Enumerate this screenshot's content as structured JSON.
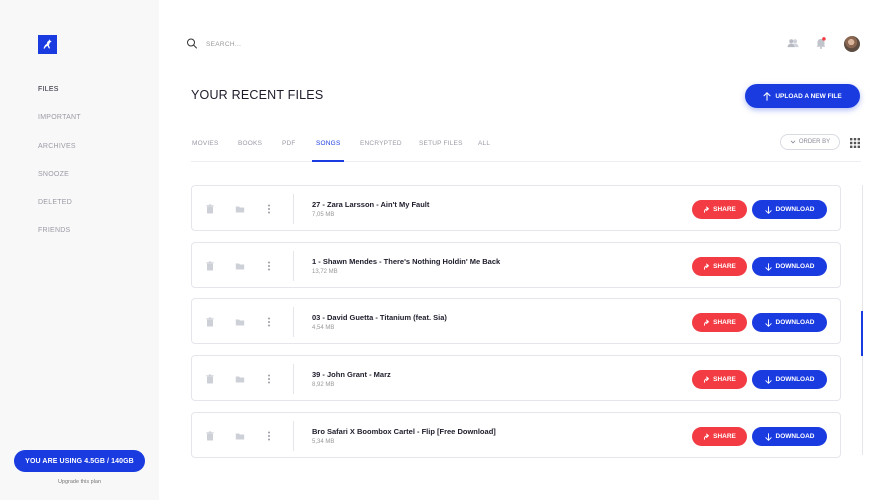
{
  "colors": {
    "brand": "#1a3be0",
    "share": "#f23b43",
    "notification": "#f23b43"
  },
  "sidebar": {
    "logo_icon": "kangaroo-logo-icon",
    "items": [
      {
        "label": "FILES",
        "active": true
      },
      {
        "label": "IMPORTANT",
        "active": false
      },
      {
        "label": "ARCHIVES",
        "active": false
      },
      {
        "label": "SNOOZE",
        "active": false
      },
      {
        "label": "DELETED",
        "active": false
      },
      {
        "label": "FRIENDS",
        "active": false
      }
    ],
    "usage_label": "YOU ARE USING 4.5GB / 140GB",
    "upgrade_label": "Upgrade this plan"
  },
  "header": {
    "search_placeholder": "SEARCH...",
    "icons": [
      "search-icon",
      "users-icon",
      "bell-icon",
      "avatar"
    ]
  },
  "main": {
    "title": "YOUR RECENT FILES",
    "upload_label": "UPLOAD A NEW FILE",
    "tabs": [
      {
        "label": "MOVIES",
        "active": false
      },
      {
        "label": "BOOKS",
        "active": false
      },
      {
        "label": "PDF",
        "active": false
      },
      {
        "label": "SONGS",
        "active": true
      },
      {
        "label": "ENCRYPTED",
        "active": false
      },
      {
        "label": "SETUP FILES",
        "active": false
      },
      {
        "label": "ALL",
        "active": false
      }
    ],
    "order_label": "ORDER BY",
    "files": [
      {
        "name": "27 - Zara Larsson - Ain't My Fault",
        "size": "7,05 MB"
      },
      {
        "name": "1 - Shawn Mendes - There's Nothing Holdin' Me Back",
        "size": "13,72 MB"
      },
      {
        "name": "03 - David Guetta - Titanium (feat. Sia)",
        "size": "4,54 MB"
      },
      {
        "name": "39 - John Grant - Marz",
        "size": "8,92 MB"
      },
      {
        "name": "Bro Safari X Boombox Cartel - Flip [Free Download]",
        "size": "5,34 MB"
      }
    ],
    "share_label": "SHARE",
    "download_label": "DOWNLOAD"
  }
}
